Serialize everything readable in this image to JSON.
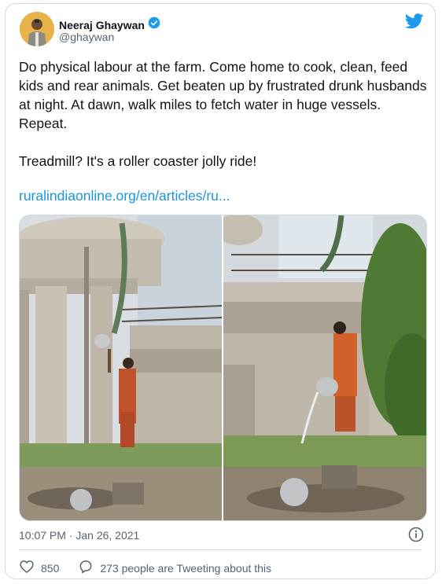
{
  "author": {
    "name": "Neeraj Ghaywan",
    "handle": "@ghaywan"
  },
  "tweet": {
    "text": "Do physical labour at the farm. Come home to cook, clean, feed kids and rear animals. Get beaten up by frustrated drunk husbands at night. At dawn, walk miles to fetch water in huge vessels.  Repeat.\n\nTreadmill? It's a roller coaster jolly ride!",
    "link": "ruralindiaonline.org/en/articles/ru...",
    "timestamp": "10:07 PM · Jan 26, 2021"
  },
  "stats": {
    "likes": "850",
    "talking": "273 people are Tweeting about this"
  },
  "colors": {
    "link": "#1b95e0",
    "verified": "#1d9bf0",
    "secondary_text": "#536471",
    "border": "#cfd9de"
  },
  "icons": [
    "verified-badge-icon",
    "twitter-bird-icon",
    "info-icon",
    "heart-icon",
    "comment-icon"
  ]
}
